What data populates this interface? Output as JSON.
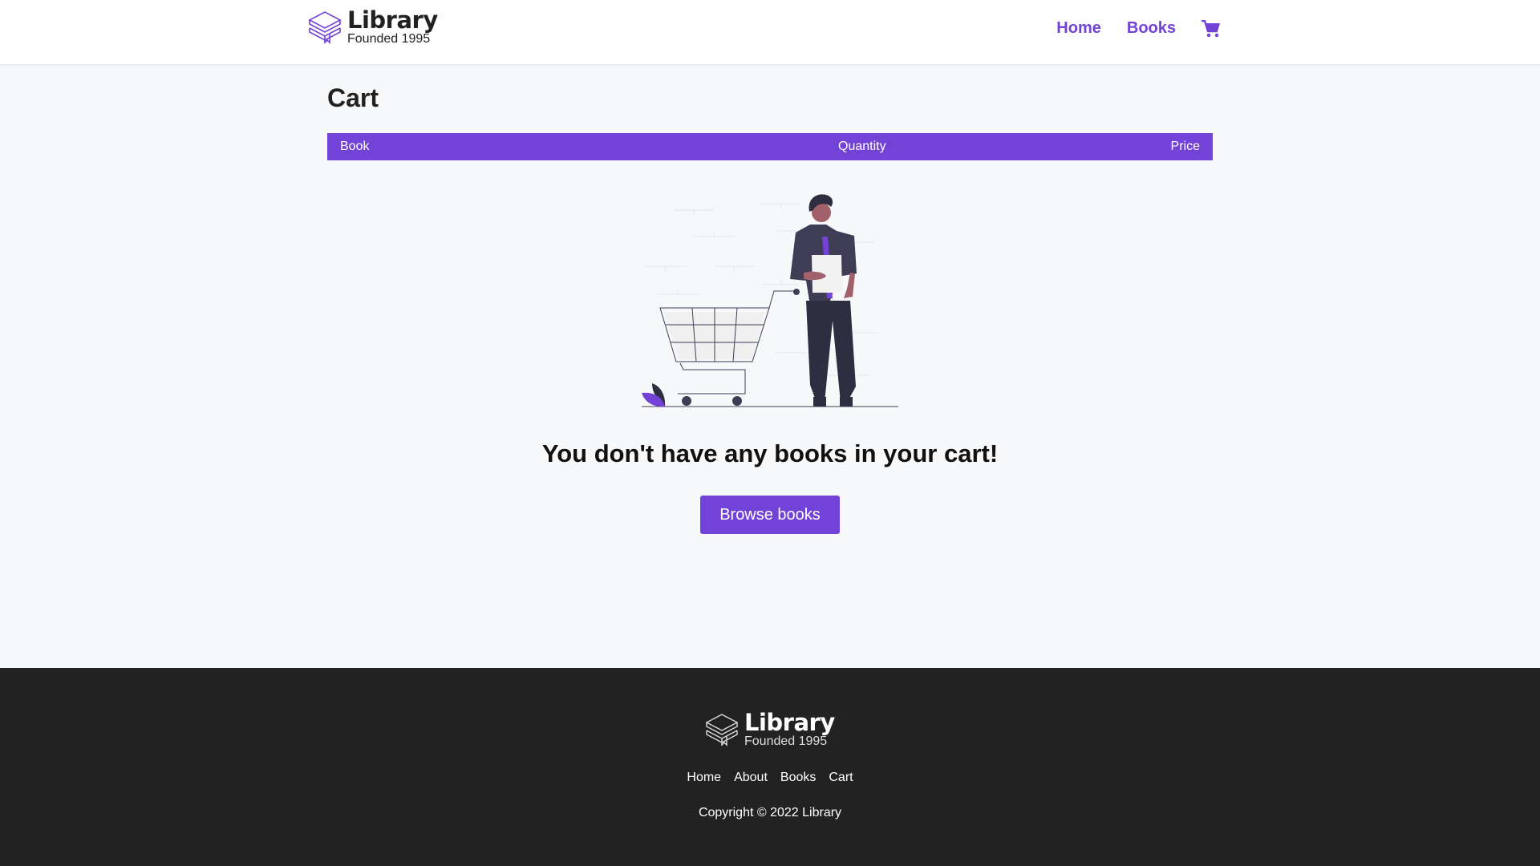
{
  "brand": {
    "name": "Library",
    "tagline": "Founded 1995",
    "accent": "#7342d6"
  },
  "nav": {
    "items": [
      {
        "label": "Home"
      },
      {
        "label": "Books"
      }
    ],
    "cart_icon": "cart-icon"
  },
  "page": {
    "title": "Cart"
  },
  "table": {
    "columns": [
      "Book",
      "Quantity",
      "Price"
    ]
  },
  "empty_state": {
    "message": "You don't have any books in your cart!",
    "button_label": "Browse books"
  },
  "footer": {
    "links": [
      {
        "label": "Home"
      },
      {
        "label": "About"
      },
      {
        "label": "Books"
      },
      {
        "label": "Cart"
      }
    ],
    "copyright": "Copyright © 2022 Library",
    "background": "#222222"
  }
}
